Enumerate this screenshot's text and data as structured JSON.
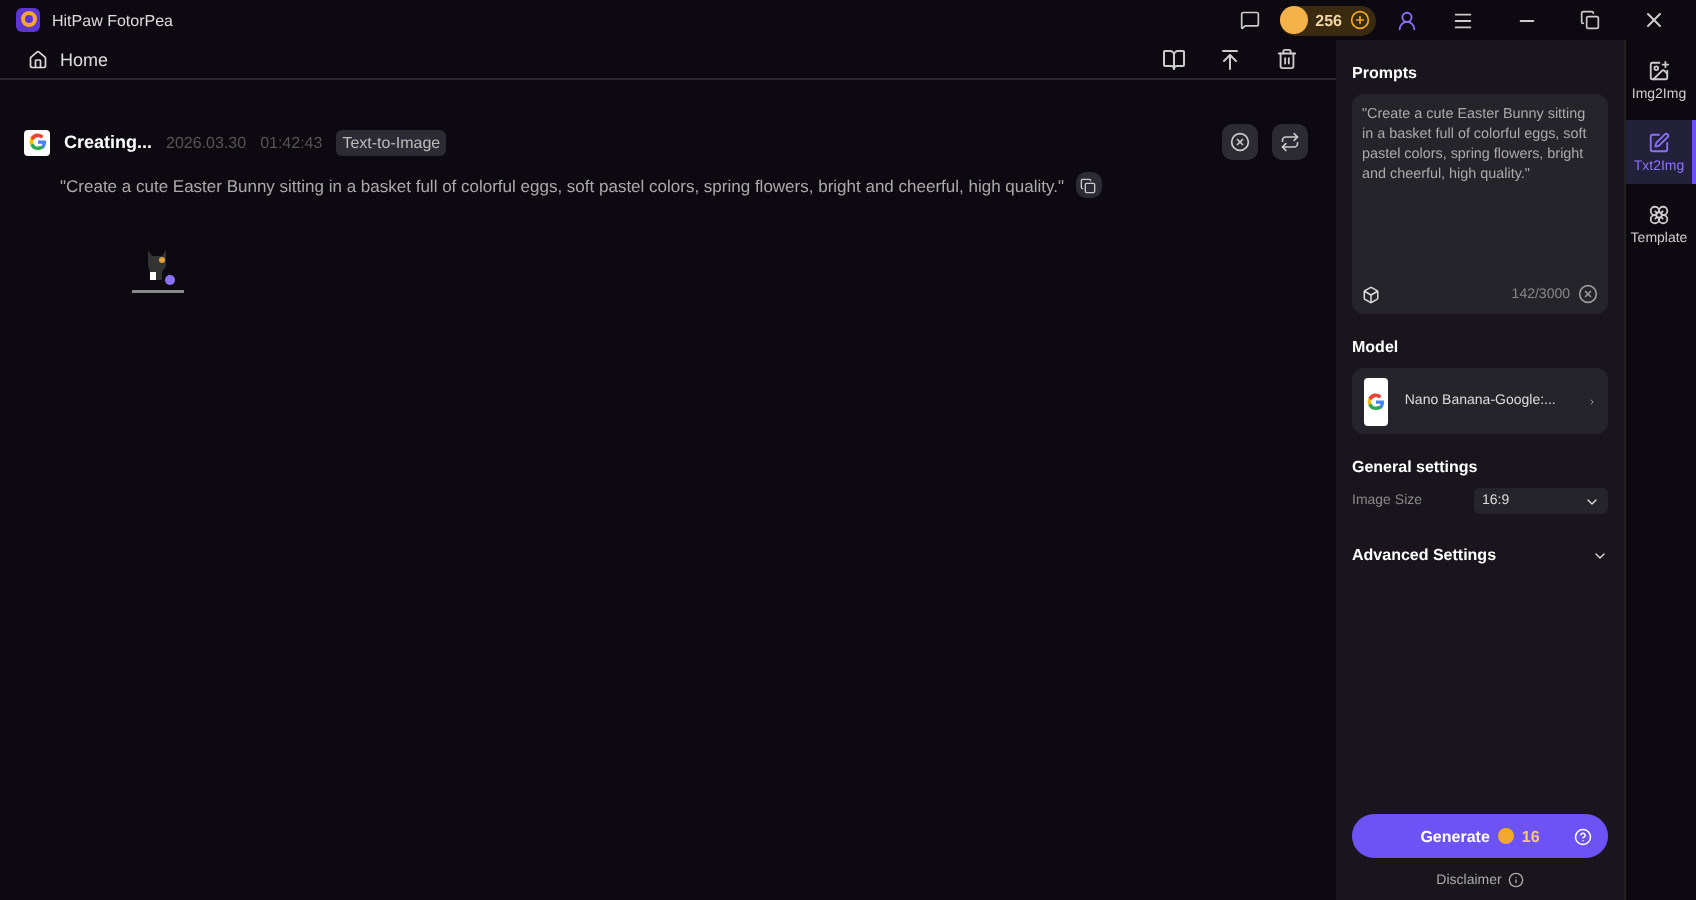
{
  "window": {
    "title": "HitPaw FotorPea",
    "credits": "256"
  },
  "nav": {
    "home": "Home"
  },
  "task": {
    "status": "Creating...",
    "date": "2026.03.30",
    "time": "01:42:43",
    "tag": "Text-to-Image",
    "prompt": "\"Create a cute Easter Bunny sitting in a basket full of colorful eggs, soft pastel colors, spring flowers, bright and cheerful, high quality.\""
  },
  "panel": {
    "prompts_title": "Prompts",
    "prompt_value": "\"Create a cute Easter Bunny sitting in a basket full of colorful eggs, soft pastel colors, spring flowers, bright and cheerful, high quality.\"",
    "count": "142/3000",
    "model_title": "Model",
    "model_name": "Nano Banana-Google:...",
    "general_title": "General settings",
    "image_size_label": "Image Size",
    "image_size_value": "16:9",
    "advanced_title": "Advanced Settings",
    "advanced_expanded": false,
    "generate": "Generate",
    "cost": "16",
    "disclaimer": "Disclaimer"
  },
  "side_tabs": [
    {
      "label": "Img2Img",
      "kind": "image",
      "selected": false
    },
    {
      "label": "Txt2Img",
      "kind": "text",
      "selected": true
    },
    {
      "label": "Template",
      "kind": "template",
      "selected": false
    }
  ]
}
